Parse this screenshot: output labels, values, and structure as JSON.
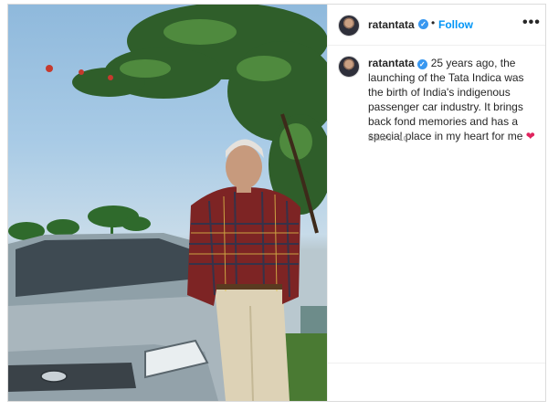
{
  "post": {
    "username": "ratantata",
    "verified_mark": "✓",
    "separator": "•",
    "follow_label": "Follow",
    "more_label": "•••",
    "caption": {
      "username": "ratantata",
      "text": "25 years ago, the launching of the Tata Indica was the birth of India's indigenous passenger car industry. It brings back fond memories and has a special place in my heart for me",
      "emoji": "❤"
    },
    "edited_label": "Edited",
    "meta_separator": "·",
    "age": "1d"
  },
  "icons": {
    "verified": "verified-badge-icon",
    "more": "more-options-icon",
    "heart": "red-heart-emoji"
  },
  "colors": {
    "follow": "#0095f6",
    "verified": "#3897f0",
    "heart": "#e0245e",
    "meta": "#8e8e8e"
  }
}
